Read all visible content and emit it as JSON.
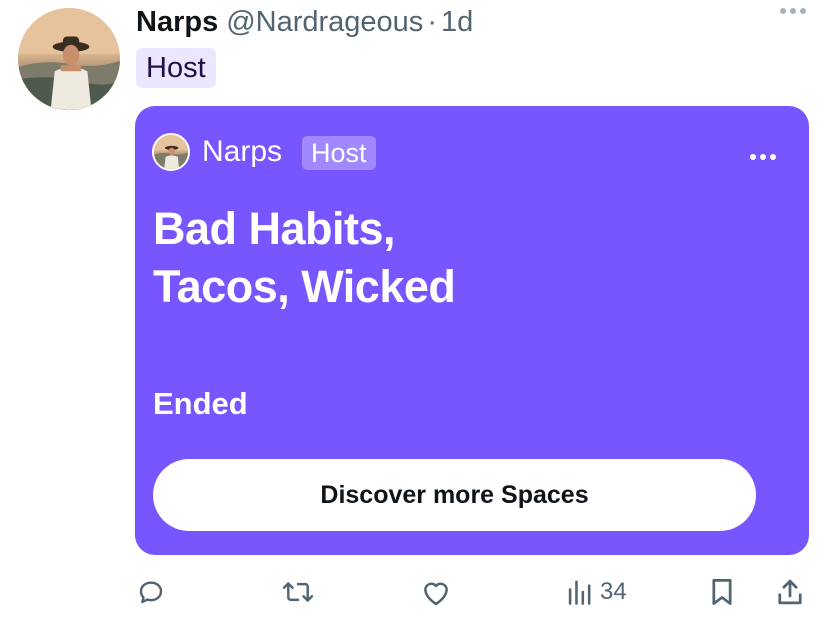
{
  "post": {
    "author": {
      "display_name": "Narps",
      "handle": "@Nardrageous",
      "separator": "·",
      "time": "1d",
      "role_badge": "Host",
      "avatar_icon": "profile-photo"
    },
    "more_icon": "ellipsis-icon"
  },
  "space_card": {
    "background_color": "#7856ff",
    "host_name": "Narps",
    "host_badge": "Host",
    "title_lines": [
      "Bad Habits,",
      "Tacos, Wicked"
    ],
    "status": "Ended",
    "button_label": "Discover more Spaces",
    "more_icon": "ellipsis-icon"
  },
  "actions": {
    "reply_icon": "reply-icon",
    "retweet_icon": "retweet-icon",
    "like_icon": "heart-icon",
    "views_icon": "bar-chart-icon",
    "views_count": "34",
    "bookmark_icon": "bookmark-icon",
    "share_icon": "share-icon"
  }
}
